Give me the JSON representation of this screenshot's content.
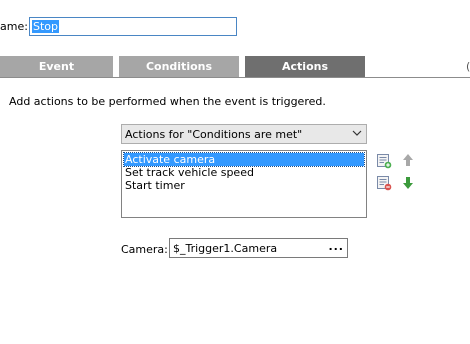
{
  "name_row": {
    "label": "ame:",
    "value": "Stop"
  },
  "tabs": [
    {
      "label": "Event",
      "active": false
    },
    {
      "label": "Conditions",
      "active": false
    },
    {
      "label": "Actions",
      "active": true
    }
  ],
  "edge_fragment": "(",
  "description": "Add actions to be performed when the event is triggered.",
  "action_set": {
    "selected": "Actions for \"Conditions are met\""
  },
  "actions_list": {
    "items": [
      {
        "label": "Activate camera",
        "selected": true
      },
      {
        "label": "Set track vehicle speed",
        "selected": false
      },
      {
        "label": "Start timer",
        "selected": false
      }
    ]
  },
  "side_buttons": {
    "add_icon": "list-add-icon",
    "remove_icon": "list-remove-icon",
    "move_up_icon": "arrow-up-icon",
    "move_down_icon": "arrow-down-icon"
  },
  "camera": {
    "label": "Camera:",
    "value": "$_Trigger1.Camera",
    "browse": "..."
  },
  "colors": {
    "selection": "#3399ff",
    "tab_inactive": "#a6a6a6",
    "tab_active": "#6f6f6f",
    "add_green": "#4caf50",
    "remove_red": "#d9534f",
    "arrow_up_gray": "#9e9e9e",
    "arrow_down_green": "#3c9a3c"
  }
}
